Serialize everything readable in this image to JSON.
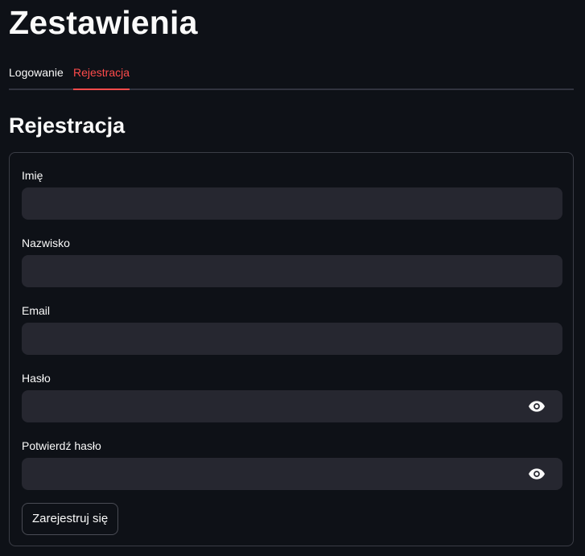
{
  "page": {
    "title": "Zestawienia"
  },
  "tabs": [
    {
      "label": "Logowanie",
      "active": false
    },
    {
      "label": "Rejestracja",
      "active": true
    }
  ],
  "section": {
    "title": "Rejestracja"
  },
  "form": {
    "fields": [
      {
        "label": "Imię",
        "value": "",
        "type": "text"
      },
      {
        "label": "Nazwisko",
        "value": "",
        "type": "text"
      },
      {
        "label": "Email",
        "value": "",
        "type": "text"
      },
      {
        "label": "Hasło",
        "value": "",
        "type": "password",
        "icon": "eye-icon"
      },
      {
        "label": "Potwierdź hasło",
        "value": "",
        "type": "password",
        "icon": "eye-icon"
      }
    ],
    "submit_label": "Zarejestruj się"
  },
  "colors": {
    "background": "#0e1117",
    "input_background": "#262730",
    "accent": "#ff4b4b",
    "text": "#fafafa"
  }
}
